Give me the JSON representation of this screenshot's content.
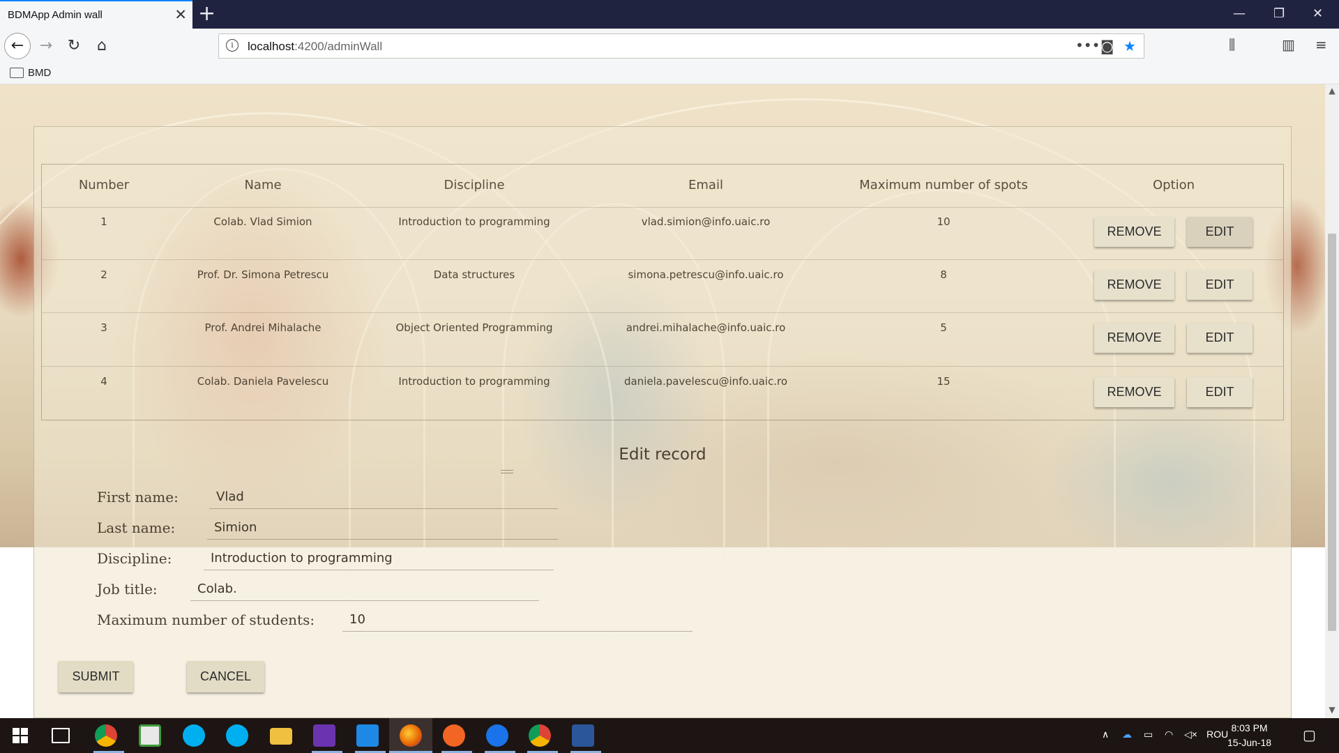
{
  "browser": {
    "tab_title": "BDMApp Admin wall",
    "tab_close": "✕",
    "new_tab": "+",
    "url_host": "localhost",
    "url_path": ":4200/adminWall",
    "bookmark_folder": "BMD",
    "window_controls": {
      "minimize": "—",
      "restore": "❐",
      "close": "✕"
    }
  },
  "table": {
    "headers": [
      "Number",
      "Name",
      "Discipline",
      "Email",
      "Maximum number of spots",
      "Option"
    ],
    "rows": [
      {
        "number": "1",
        "name": "Colab. Vlad Simion",
        "discipline": "Introduction to programming",
        "email": "vlad.simion@info.uaic.ro",
        "spots": "10",
        "remove": "REMOVE",
        "edit": "EDIT"
      },
      {
        "number": "2",
        "name": "Prof. Dr. Simona Petrescu",
        "discipline": "Data structures",
        "email": "simona.petrescu@info.uaic.ro",
        "spots": "8",
        "remove": "REMOVE",
        "edit": "EDIT"
      },
      {
        "number": "3",
        "name": "Prof. Andrei Mihalache",
        "discipline": "Object Oriented Programming",
        "email": "andrei.mihalache@info.uaic.ro",
        "spots": "5",
        "remove": "REMOVE",
        "edit": "EDIT"
      },
      {
        "number": "4",
        "name": "Colab. Daniela Pavelescu",
        "discipline": "Introduction to programming",
        "email": "daniela.pavelescu@info.uaic.ro",
        "spots": "15",
        "remove": "REMOVE",
        "edit": "EDIT"
      }
    ]
  },
  "edit_form": {
    "title": "Edit record",
    "fields": {
      "first_name": {
        "label": "First name:",
        "value": "Vlad"
      },
      "last_name": {
        "label": "Last name:",
        "value": "Simion"
      },
      "discipline": {
        "label": "Discipline:",
        "value": "Introduction to programming"
      },
      "job_title": {
        "label": "Job title:",
        "value": "Colab."
      },
      "max_students": {
        "label": "Maximum number of students:",
        "value": "10"
      }
    },
    "submit_label": "SUBMIT",
    "cancel_label": "CANCEL"
  },
  "taskbar": {
    "language": "ROU",
    "time": "8:03 PM",
    "date": "15-Jun-18"
  },
  "colors": {
    "accent": "#0a84ff",
    "tab_bar": "#202340",
    "panel_text": "#4a3f30",
    "button_bg": "#e7e1cc"
  }
}
